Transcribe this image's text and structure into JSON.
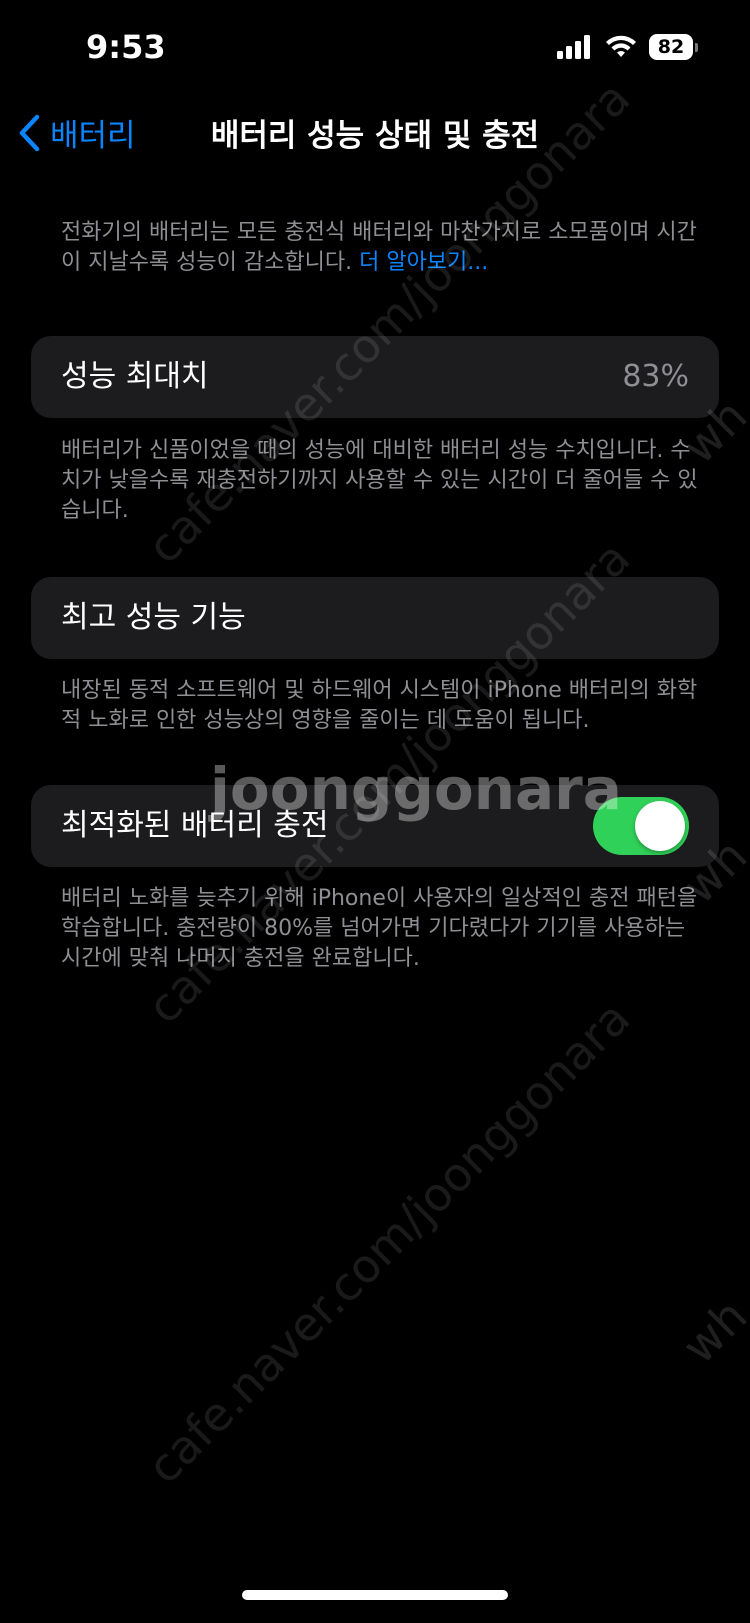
{
  "status_bar": {
    "time": "9:53",
    "battery": "82"
  },
  "nav": {
    "back_label": "배터리",
    "title": "배터리 성능 상태 및 충전"
  },
  "intro": {
    "text": "전화기의 배터리는 모든 충전식 배터리와 마찬가지로 소모품이며 시간이 지날수록 성능이 감소합니다. ",
    "link": "더 알아보기..."
  },
  "max_capacity": {
    "label": "성능 최대치",
    "value": "83%",
    "footer": "배터리가 신품이었을 때의 성능에 대비한 배터리 성능 수치입니다. 수치가 낮을수록 재충전하기까지 사용할 수 있는 시간이 더 줄어들 수 있습니다."
  },
  "peak_performance": {
    "label": "최고 성능 기능",
    "footer": "내장된 동적 소프트웨어 및 하드웨어 시스템이 iPhone 배터리의 화학적 노화로 인한 성능상의 영향을 줄이는 데 도움이 됩니다."
  },
  "optimized_charging": {
    "label": "최적화된 배터리 충전",
    "enabled": true,
    "footer": "배터리 노화를 늦추기 위해 iPhone이 사용자의 일상적인 충전 패턴을 학습합니다. 충전량이 80%를 넘어가면 기다렸다가 기기를 사용하는 시간에 맞춰 나머지 충전을 완료합니다."
  },
  "watermark": {
    "url": "cafe.naver.com/joonggonara",
    "logo": "joonggonara",
    "edge": "wh"
  },
  "colors": {
    "accent": "#0a84ff",
    "toggle_on": "#30d158",
    "card_bg": "#1c1c1e",
    "secondary_text": "#8e8e93"
  }
}
